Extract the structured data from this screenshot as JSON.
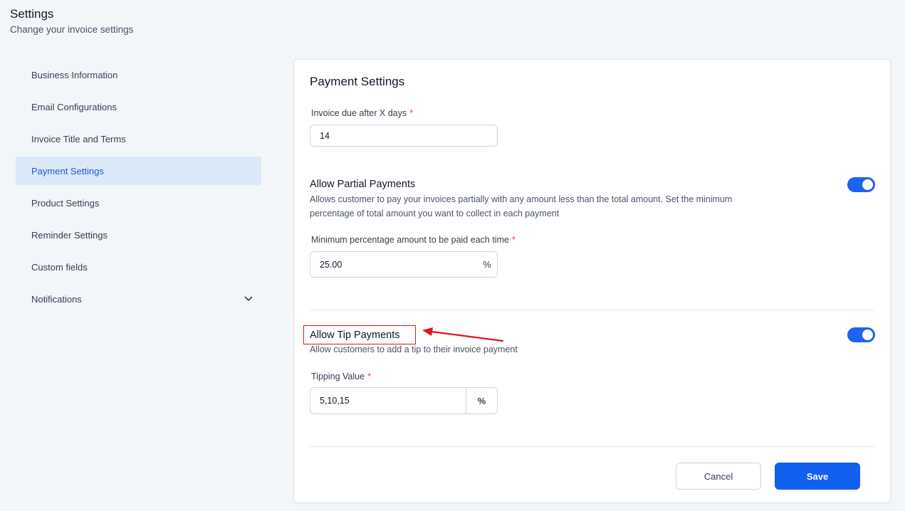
{
  "header": {
    "title": "Settings",
    "subtitle": "Change your invoice settings"
  },
  "sidebar": {
    "items": [
      {
        "label": "Business Information"
      },
      {
        "label": "Email Configurations"
      },
      {
        "label": "Invoice Title and Terms"
      },
      {
        "label": "Payment Settings",
        "active": true
      },
      {
        "label": "Product Settings"
      },
      {
        "label": "Reminder Settings"
      },
      {
        "label": "Custom fields"
      },
      {
        "label": "Notifications",
        "icon": "chevron-down-icon"
      }
    ]
  },
  "main": {
    "title": "Payment Settings",
    "due_days": {
      "label": "Invoice due after X days",
      "required_mark": "*",
      "value": "14"
    },
    "partial_payments": {
      "title": "Allow Partial Payments",
      "description_line1": "Allows customer to pay your invoices partially with any amount less than the total amount. Set the minimum",
      "description_line2": "percentage of total amount you want to collect in each payment",
      "enabled": true,
      "min_label": "Minimum percentage amount to be paid each time",
      "required_mark": "*",
      "min_value": "25.00",
      "min_suffix": "%"
    },
    "tip_payments": {
      "title": "Allow Tip Payments",
      "description": "Allow customers to add a tip to their invoice payment",
      "enabled": true,
      "value_label": "Tipping Value",
      "required_mark": "*",
      "value": "5,10,15",
      "unit": "%"
    },
    "buttons": {
      "cancel": "Cancel",
      "save": "Save"
    }
  },
  "colors": {
    "accent": "#1d63ed",
    "save_button": "#1160f0",
    "active_nav_bg": "#dbe8f7",
    "annotation": "#e3131b"
  }
}
